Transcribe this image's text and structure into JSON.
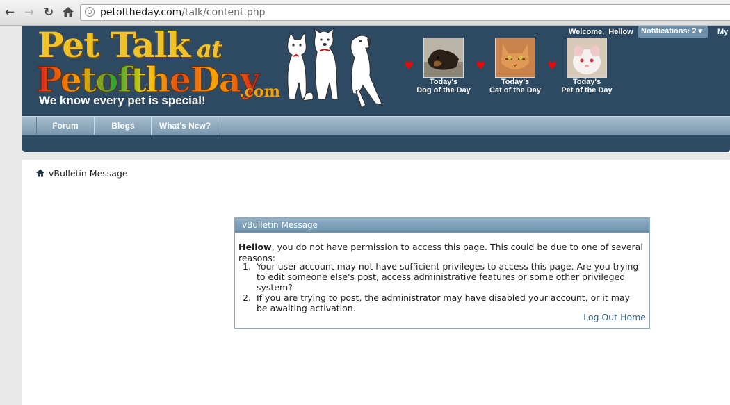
{
  "browser": {
    "url_domain": "petoftheday.com",
    "url_path": "/talk/content.php"
  },
  "header": {
    "logo_line1": "Pet Talk",
    "logo_at": "at",
    "logo_line2": "PetoftheDay",
    "logo_dotcom": ".com",
    "tagline": "We know every pet is special!",
    "welcome_label": "Welcome,",
    "username": "Hellow",
    "notifications_label": "Notifications: 2 ▾",
    "my_label": "My",
    "pets": [
      {
        "line1": "Today's",
        "line2": "Dog of the Day"
      },
      {
        "line1": "Today's",
        "line2": "Cat of the Day"
      },
      {
        "line1": "Today's",
        "line2": "Pet of the Day"
      }
    ]
  },
  "nav": {
    "tabs": [
      "Forum",
      "Blogs",
      "What's New?"
    ]
  },
  "breadcrumb": {
    "current": "vBulletin Message"
  },
  "message": {
    "title": "vBulletin Message",
    "username": "Hellow",
    "intro": ", you do not have permission to access this page. This could be due to one of several reasons:",
    "reasons": [
      "Your user account may not have sufficient privileges to access this page. Are you trying to edit someone else's post, access administrative features or some other privileged system?",
      "If you are trying to post, the administrator may have disabled your account, or it may be awaiting activation."
    ],
    "logout_label": "Log Out",
    "home_label": "Home"
  },
  "colors": {
    "header_bg": "#2e4a62",
    "nav_bg": "#7895ab",
    "link": "#2a5d84",
    "heart": "#e10b0b"
  }
}
